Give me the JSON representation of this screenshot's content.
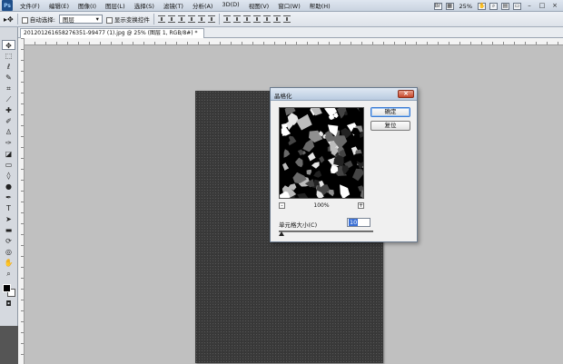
{
  "app": {
    "logo": "Ps",
    "menus": [
      "文件(F)",
      "编辑(E)",
      "图像(I)",
      "图层(L)",
      "选择(S)",
      "滤镜(T)",
      "分析(A)",
      "3D(D)",
      "视图(V)",
      "窗口(W)",
      "帮助(H)"
    ],
    "zoom": "25%",
    "window_buttons": [
      "–",
      "□",
      "×"
    ]
  },
  "options_bar": {
    "auto_select_label": "自动选择:",
    "auto_select_value": "图层",
    "show_transform_label": "显示变换控件"
  },
  "document": {
    "tab_label": "201201261658276351-99477 (1).jpg @ 25% (图层 1, RGB/8#) *"
  },
  "dialog": {
    "title": "晶格化",
    "close_label": "×",
    "ok_label": "确定",
    "reset_label": "复位",
    "zoom_out": "-",
    "zoom_in": "+",
    "preview_zoom": "100%",
    "cell_size_label": "单元格大小(C)",
    "cell_size_value": "10"
  },
  "colors": {
    "foreground": "#000000",
    "background": "#ffffff",
    "titlebar": "#b9cbe0"
  }
}
